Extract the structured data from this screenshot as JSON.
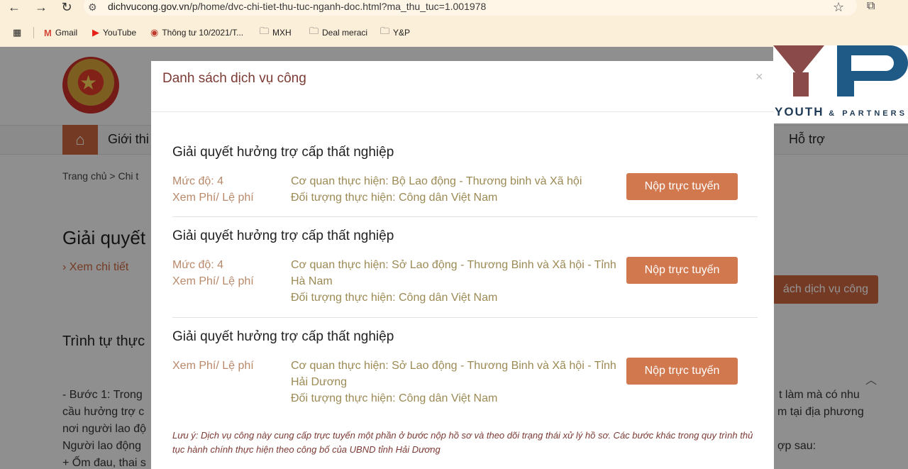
{
  "browser": {
    "url_host": "dichvucong.gov.vn",
    "url_path": "/p/home/dvc-chi-tiet-thu-tuc-nganh-doc.html?ma_thu_tuc=1.001978",
    "bookmarks": [
      {
        "label": "Gmail",
        "icon": "gmail-icon"
      },
      {
        "label": "YouTube",
        "icon": "youtube-icon"
      },
      {
        "label": "Thông tư 10/2021/T...",
        "icon": "site-icon"
      },
      {
        "label": "MXH",
        "icon": "folder-icon"
      },
      {
        "label": "Deal meraci",
        "icon": "folder-icon"
      },
      {
        "label": "Y&P",
        "icon": "folder-icon"
      }
    ]
  },
  "background_page": {
    "nav_intro": "Giới thi",
    "nav_support": "Hỗ trợ",
    "breadcrumb": "Trang chủ  >  Chi t",
    "title": "Giải quyết",
    "detail_link": "›   Xem chi tiết",
    "list_button": "ách dịch vụ công",
    "section": "Trình tự thực",
    "lines_left": [
      "- Bước 1: Trong",
      "cầu hưởng trợ c",
      "nơi người lao độ",
      "Người lao động",
      "+ Ốm đau, thai s"
    ],
    "lines_right": [
      "t làm mà có nhu",
      "m tại địa phương",
      "ợp sau:"
    ]
  },
  "logo": {
    "text_main": "YOUTH",
    "text_small": "& PARTNERS"
  },
  "modal": {
    "title": "Danh sách dịch vụ công",
    "close": "×",
    "services": [
      {
        "name": "Giải quyết hưởng trợ cấp thất nghiệp",
        "level": "Mức độ: 4",
        "fee": "Xem Phí/ Lệ phí",
        "agency": "Cơ quan thực hiện: Bộ Lao động - Thương binh và Xã hội",
        "target": "Đối tượng thực hiện: Công dân Việt Nam",
        "button": "Nộp trực tuyến"
      },
      {
        "name": "Giải quyết hưởng trợ cấp thất nghiệp",
        "level": "Mức độ: 4",
        "fee": "Xem Phí/ Lệ phí",
        "agency": "Cơ quan thực hiện: Sở Lao động - Thương Binh và Xã hội - Tỉnh Hà Nam",
        "target": "Đối tượng thực hiện: Công dân Việt Nam",
        "button": "Nộp trực tuyến"
      },
      {
        "name": "Giải quyết hưởng trợ cấp thất nghiệp",
        "level": "",
        "fee": "Xem Phí/ Lệ phí",
        "agency": "Cơ quan thực hiện: Sở Lao động - Thương Binh và Xã hội - Tỉnh Hải Dương",
        "target": "Đối tượng thực hiện: Công dân Việt Nam",
        "button": "Nộp trực tuyến"
      }
    ],
    "note": "Lưu ý: Dịch vụ công này cung cấp trực tuyến một phần ở bước nộp hồ sơ và theo dõi trạng thái xử lý hồ sơ. Các bước khác trong quy trình thủ tục hành chính thực hiện theo công bố của UBND tỉnh Hải Dương"
  }
}
